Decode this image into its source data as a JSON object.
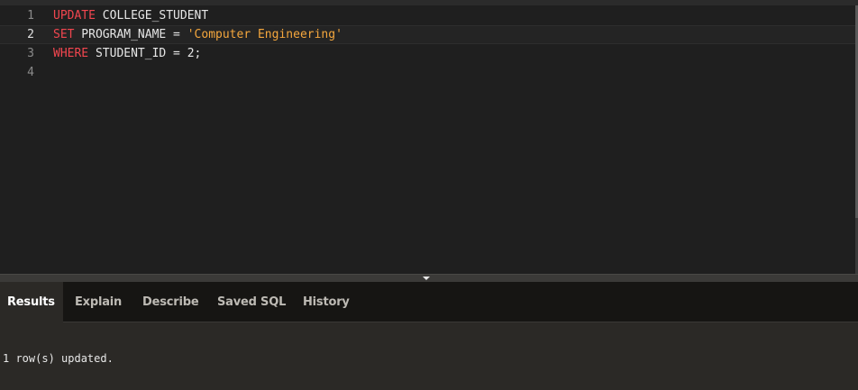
{
  "editor": {
    "lines": [
      {
        "number": "1",
        "tokens": [
          {
            "text": "UPDATE",
            "type": "keyword"
          },
          {
            "text": " COLLEGE_STUDENT",
            "type": "plain"
          }
        ]
      },
      {
        "number": "2",
        "tokens": [
          {
            "text": "SET",
            "type": "keyword"
          },
          {
            "text": " PROGRAM_NAME = ",
            "type": "plain"
          },
          {
            "text": "'Computer Engineering'",
            "type": "string"
          }
        ]
      },
      {
        "number": "3",
        "tokens": [
          {
            "text": "WHERE",
            "type": "keyword"
          },
          {
            "text": " STUDENT_ID = 2;",
            "type": "plain"
          }
        ]
      },
      {
        "number": "4",
        "tokens": []
      }
    ],
    "active_line": 2
  },
  "tabs": [
    {
      "label": "Results",
      "selected": true
    },
    {
      "label": "Explain",
      "selected": false
    },
    {
      "label": "Describe",
      "selected": false
    },
    {
      "label": "Saved SQL",
      "selected": false
    },
    {
      "label": "History",
      "selected": false
    }
  ],
  "results": {
    "message": "1 row(s) updated."
  },
  "colors": {
    "keyword": "#f2464f",
    "string": "#f5a73d",
    "plain": "#e6e6e6"
  }
}
